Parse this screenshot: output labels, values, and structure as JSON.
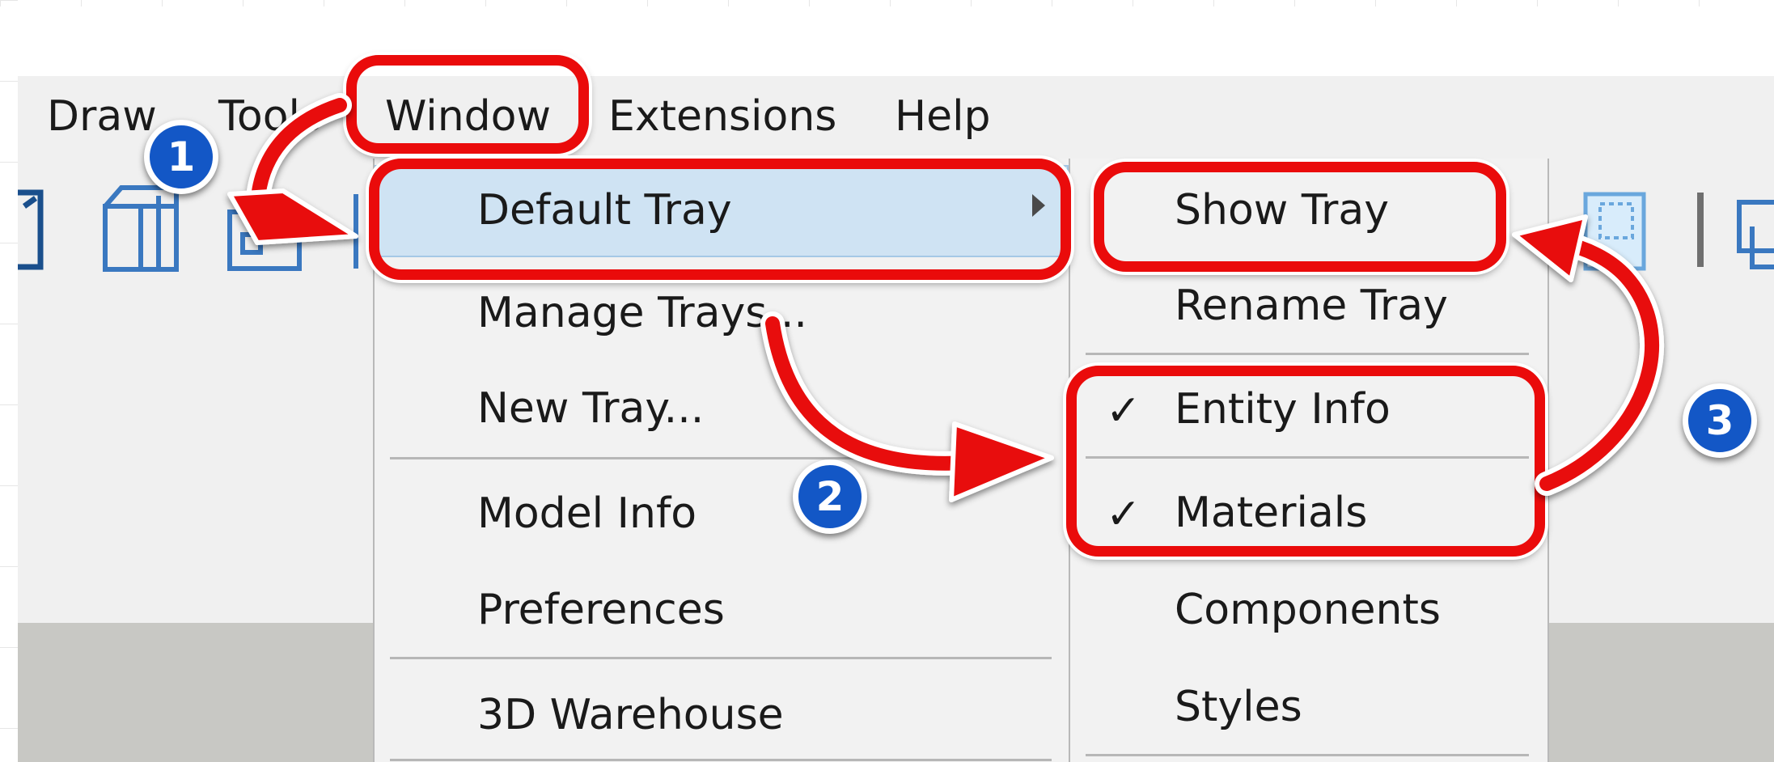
{
  "menubar": {
    "items": [
      {
        "label": "Draw"
      },
      {
        "label": "Tools"
      },
      {
        "label": "Window"
      },
      {
        "label": "Extensions"
      },
      {
        "label": "Help"
      }
    ]
  },
  "window_menu": {
    "items": [
      {
        "label": "Default Tray",
        "has_submenu": true,
        "highlighted": true
      },
      {
        "label": "Manage Trays..."
      },
      {
        "label": "New Tray..."
      },
      {
        "label": "Model Info"
      },
      {
        "label": "Preferences"
      },
      {
        "label": "3D Warehouse"
      }
    ]
  },
  "tray_submenu": {
    "items": [
      {
        "label": "Show Tray"
      },
      {
        "label": "Rename Tray"
      },
      {
        "label": "Entity Info",
        "checked": true,
        "check": "✓"
      },
      {
        "label": "Materials",
        "checked": true,
        "check": "✓"
      },
      {
        "label": "Components"
      },
      {
        "label": "Styles"
      }
    ]
  },
  "steps": [
    {
      "number": "1"
    },
    {
      "number": "2"
    },
    {
      "number": "3"
    }
  ],
  "icons": {
    "submenu_arrow": "triangle-right-icon",
    "checkmark": "check-icon"
  },
  "colors": {
    "callout": "#ea0b0b",
    "badge": "#1357c6",
    "highlight": "#cfe3f3"
  }
}
